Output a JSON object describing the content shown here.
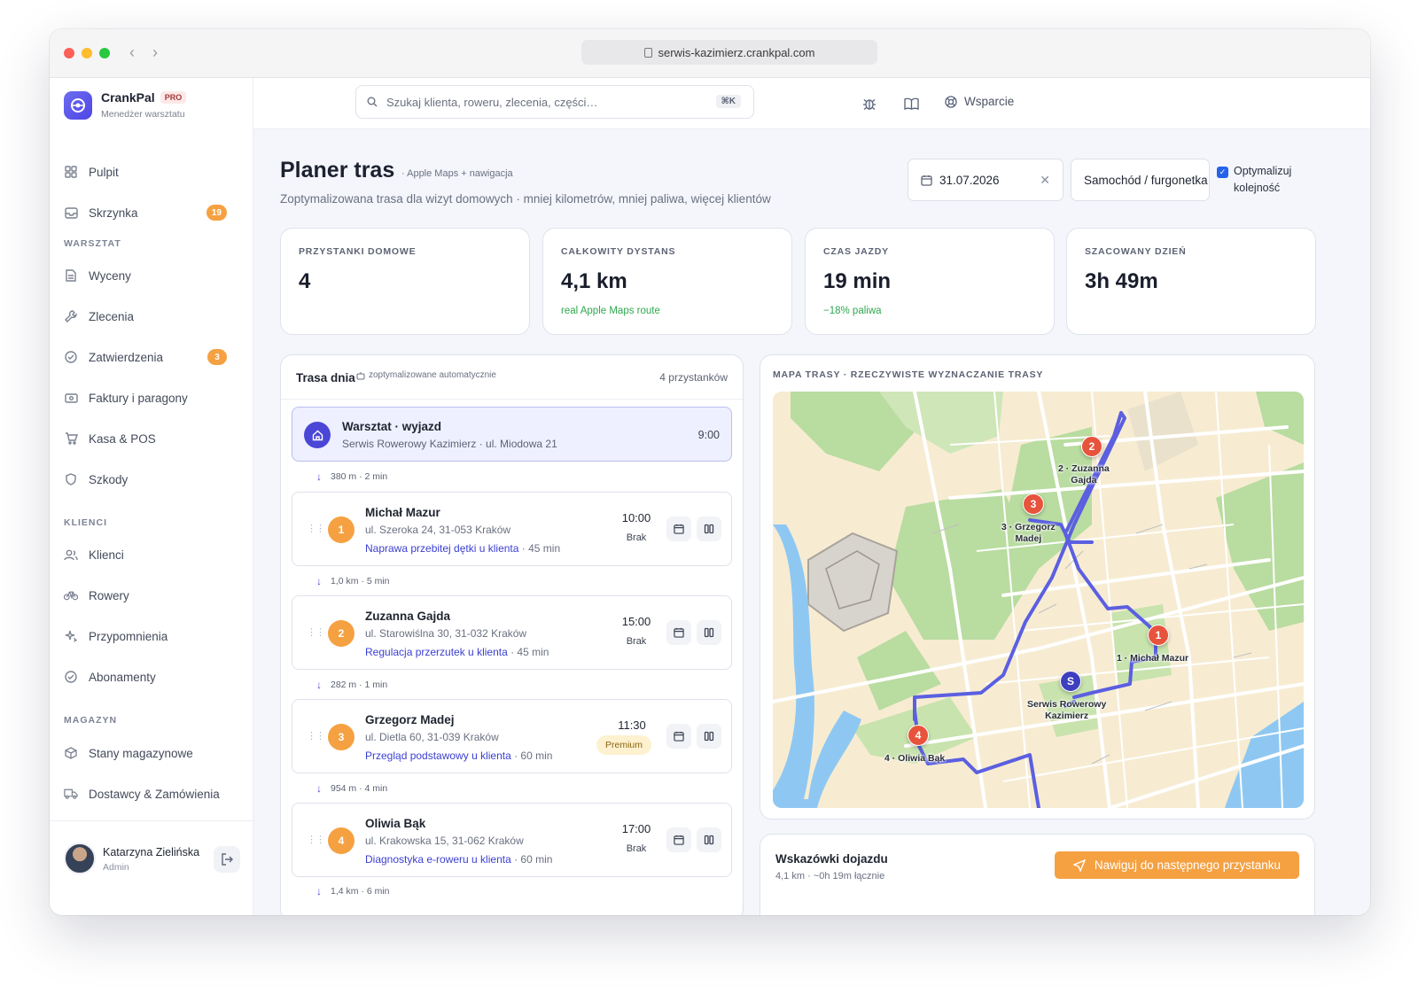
{
  "browser": {
    "url": "serwis-kazimierz.crankpal.com"
  },
  "brand": {
    "name": "CrankPal",
    "badge": "PRO",
    "subtitle": "Menedżer warsztatu"
  },
  "sidebar": {
    "items": [
      {
        "label": "Pulpit",
        "icon": "dashboard-icon"
      },
      {
        "label": "Skrzynka",
        "icon": "inbox-icon",
        "badge": "19"
      }
    ],
    "sections": [
      {
        "title": "WARSZTAT",
        "items": [
          {
            "label": "Wyceny",
            "icon": "document-icon"
          },
          {
            "label": "Zlecenia",
            "icon": "wrench-icon"
          },
          {
            "label": "Zatwierdzenia",
            "icon": "check-circle-icon",
            "badge": "3"
          },
          {
            "label": "Faktury i paragony",
            "icon": "receipt-icon"
          },
          {
            "label": "Kasa & POS",
            "icon": "cart-icon"
          },
          {
            "label": "Szkody",
            "icon": "shield-icon"
          }
        ]
      },
      {
        "title": "KLIENCI",
        "items": [
          {
            "label": "Klienci",
            "icon": "users-icon"
          },
          {
            "label": "Rowery",
            "icon": "bike-icon"
          },
          {
            "label": "Przypomnienia",
            "icon": "sparkle-icon"
          },
          {
            "label": "Abonamenty",
            "icon": "check-circle-icon"
          }
        ]
      },
      {
        "title": "MAGAZYN",
        "items": [
          {
            "label": "Stany magazynowe",
            "icon": "box-icon"
          },
          {
            "label": "Dostawcy & Zamówienia",
            "icon": "truck-icon"
          }
        ]
      }
    ],
    "user": {
      "name": "Katarzyna Zielińska",
      "role": "Admin"
    }
  },
  "topbar": {
    "search_placeholder": "Szukaj klienta, roweru, zlecenia, części…",
    "shortcut": "⌘K",
    "support_label": "Wsparcie"
  },
  "page": {
    "title": "Planer tras",
    "tag": "· Apple Maps + nawigacja",
    "subtitle": "Zoptymalizowana trasa dla wizyt domowych · mniej kilometrów, mniej paliwa, więcej klientów",
    "date": "31.07.2026",
    "vehicle": "Samochód / furgonetka",
    "optimize_label_1": "Optymalizuj",
    "optimize_label_2": "kolejność",
    "optimize_checked": true
  },
  "stats": [
    {
      "label": "PRZYSTANKI DOMOWE",
      "value": "4",
      "note": ""
    },
    {
      "label": "CAŁKOWITY DYSTANS",
      "value": "4,1 km",
      "note": "real Apple Maps route"
    },
    {
      "label": "CZAS JAZDY",
      "value": "19 min",
      "note": "−18% paliwa"
    },
    {
      "label": "SZACOWANY DZIEŃ",
      "value": "3h 49m",
      "note": ""
    }
  ],
  "route": {
    "title": "Trasa dnia",
    "auto_label": "zoptymalizowane automatycznie",
    "count": "4 przystanków",
    "start": {
      "title": "Warsztat · wyjazd",
      "address": "Serwis Rowerowy Kazimierz · ul. Miodowa 21",
      "time": "9:00"
    },
    "legs": [
      "380 m · 2 min",
      "1,0 km · 5 min",
      "282 m · 1 min",
      "954 m · 4 min",
      "1,4 km · 6 min"
    ],
    "stops": [
      {
        "num": "1",
        "name": "Michał Mazur",
        "address": "ul. Szeroka 24, 31-053 Kraków",
        "service": "Naprawa przebitej dętki u klienta",
        "duration": " · 45 min",
        "time": "10:00",
        "status": "Brak"
      },
      {
        "num": "2",
        "name": "Zuzanna Gajda",
        "address": "ul. Starowiślna 30, 31-032 Kraków",
        "service": "Regulacja przerzutek u klienta",
        "duration": " · 45 min",
        "time": "15:00",
        "status": "Brak"
      },
      {
        "num": "3",
        "name": "Grzegorz Madej",
        "address": "ul. Dietla 60, 31-039 Kraków",
        "service": "Przegląd podstawowy u klienta",
        "duration": " · 60 min",
        "time": "11:30",
        "status": "Premium"
      },
      {
        "num": "4",
        "name": "Oliwia Bąk",
        "address": "ul. Krakowska 15, 31-062 Kraków",
        "service": "Diagnostyka e-roweru u klienta",
        "duration": " · 60 min",
        "time": "17:00",
        "status": "Brak"
      }
    ]
  },
  "map": {
    "title": "MAPA TRASY · RZECZYWISTE WYZNACZANIE TRASY",
    "pins": [
      {
        "id": "2",
        "label_1": "2 · Zuzanna",
        "label_2": "Gajda"
      },
      {
        "id": "3",
        "label_1": "3 · Grzegorz",
        "label_2": "Madej"
      },
      {
        "id": "1",
        "label_1": "1 · Michał Mazur",
        "label_2": ""
      },
      {
        "id": "S",
        "label_1": "Serwis Rowerowy",
        "label_2": "Kazimierz"
      },
      {
        "id": "4",
        "label_1": "4 · Oliwia Bąk",
        "label_2": ""
      }
    ],
    "colors": {
      "route": "#5b5fe0",
      "river": "#8ec8f2",
      "park": "#b9dca0",
      "block": "#f7ecd2"
    }
  },
  "directions": {
    "title": "Wskazówki dojazdu",
    "summary": "4,1 km · ~0h 19m łącznie",
    "button": "Nawiguj do następnego przystanku"
  }
}
